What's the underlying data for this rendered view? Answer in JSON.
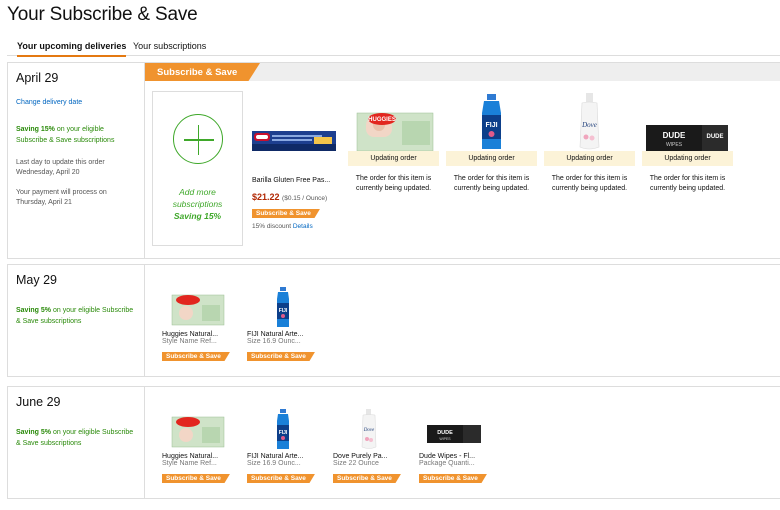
{
  "title": "Your Subscribe & Save",
  "tabs": [
    {
      "label": "Your upcoming deliveries",
      "active": true
    },
    {
      "label": "Your subscriptions",
      "active": false
    }
  ],
  "colors": {
    "accent": "#f0932e",
    "green": "#2a8a0a",
    "link": "#0066c0",
    "price": "#b12704"
  },
  "april": {
    "date": "April 29",
    "change_link": "Change delivery date",
    "saving_bold": "Saving 15%",
    "saving_rest": " on your eligible Subscribe & Save subscriptions",
    "last_day_label": "Last day to update this order",
    "last_day": "Wednesday, April 20",
    "payment_label": "Your payment will process on",
    "payment_day": "Thursday, April 21",
    "flag": "Subscribe & Save",
    "add_card": {
      "line1": "Add more",
      "line2": "subscriptions",
      "line3": "Saving 15%"
    },
    "barilla": {
      "name": "Barilla Gluten Free Pas...",
      "price": "$21.22",
      "unit": "($0.15 / Ounce)",
      "badge": "Subscribe & Save",
      "discount": "15% discount",
      "details": "Details"
    },
    "updating": [
      {
        "item": "Huggies wipes",
        "label": "Updating order",
        "note": "The order for this item is currently being updated."
      },
      {
        "item": "FIJI water",
        "label": "Updating order",
        "note": "The order for this item is currently being updated."
      },
      {
        "item": "Dove body wash",
        "label": "Updating order",
        "note": "The order for this item is currently being updated."
      },
      {
        "item": "Dude Wipes",
        "label": "Updating order",
        "note": "The order for this item is currently being updated."
      }
    ]
  },
  "may": {
    "date": "May 29",
    "saving_bold": "Saving 5%",
    "saving_rest": " on your eligible Subscribe & Save subscriptions",
    "items": [
      {
        "name": "Huggies Natural...",
        "sub": "Style Name Ref...",
        "badge": "Subscribe & Save"
      },
      {
        "name": "FIJI Natural Arte...",
        "sub": "Size 16.9 Ounc...",
        "badge": "Subscribe & Save"
      }
    ]
  },
  "june": {
    "date": "June 29",
    "saving_bold": "Saving 5%",
    "saving_rest": " on your eligible Subscribe & Save subscriptions",
    "items": [
      {
        "name": "Huggies Natural...",
        "sub": "Style Name Ref...",
        "badge": "Subscribe & Save"
      },
      {
        "name": "FIJI Natural Arte...",
        "sub": "Size 16.9 Ounc...",
        "badge": "Subscribe & Save"
      },
      {
        "name": "Dove Purely Pa...",
        "sub": "Size 22 Ounce",
        "badge": "Subscribe & Save"
      },
      {
        "name": "Dude Wipes - Fl...",
        "sub": "Package Quanti...",
        "badge": "Subscribe & Save"
      }
    ]
  }
}
